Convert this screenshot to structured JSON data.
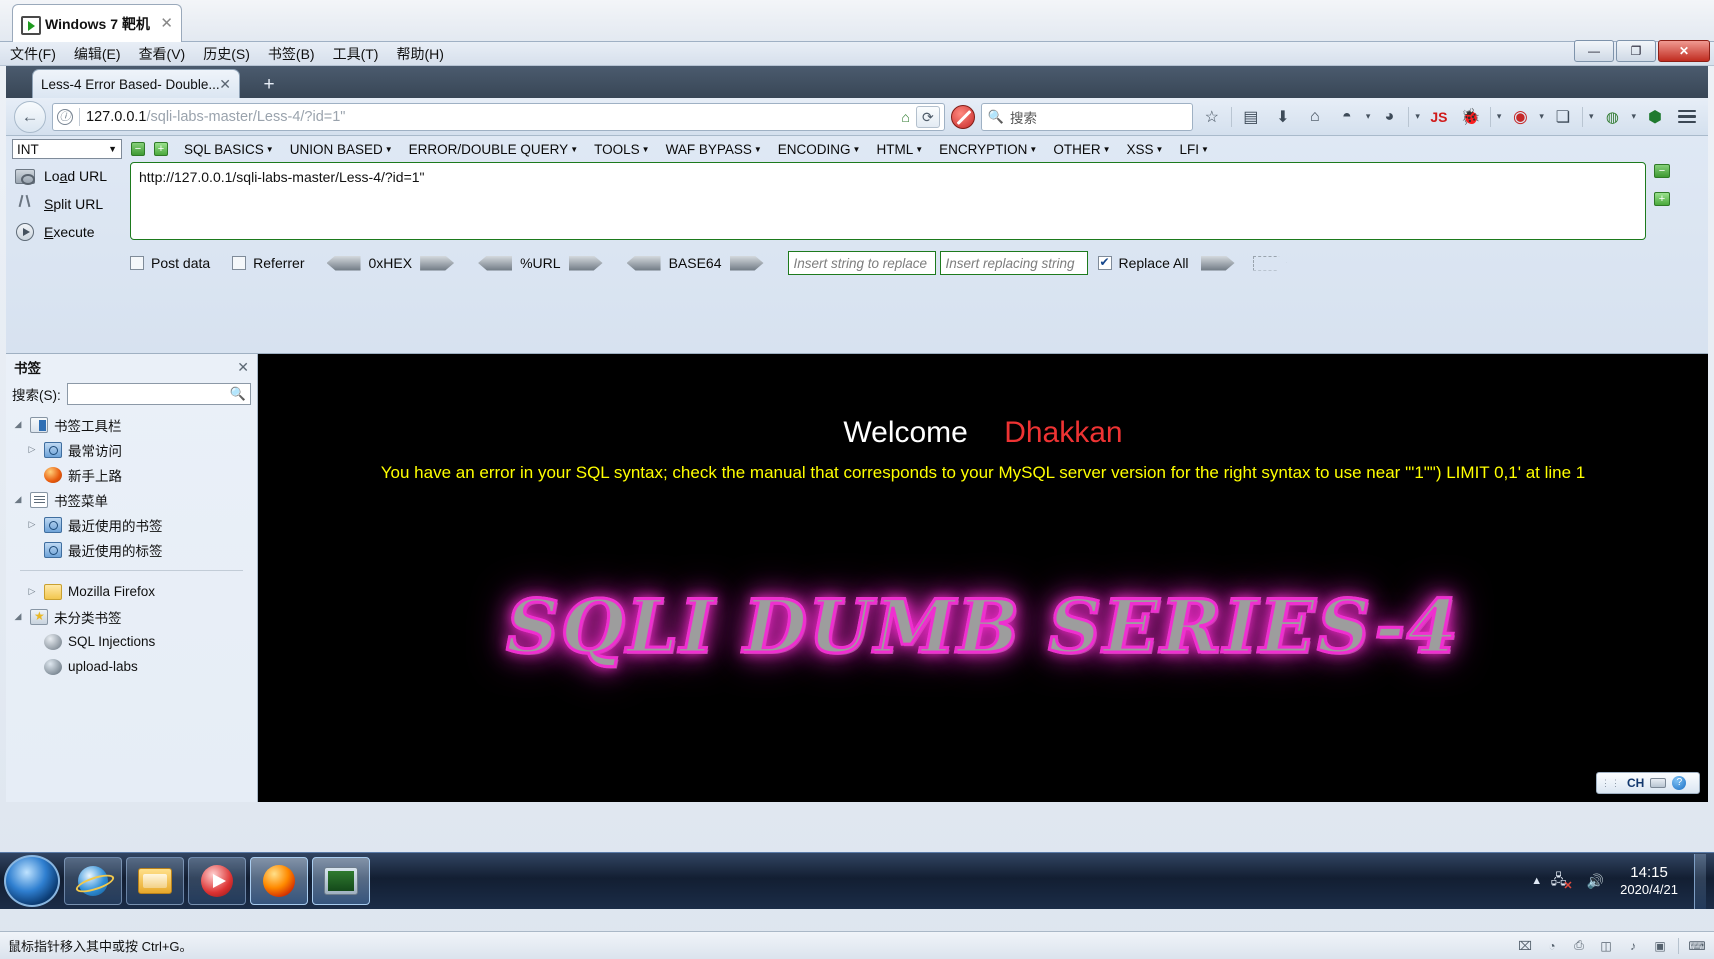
{
  "vm": {
    "tab_title": "Windows 7 靶机",
    "tab_icon": "vm-screen-icon",
    "close_label": "✕",
    "menus": [
      {
        "label": "文件(F)",
        "name": "menu-file"
      },
      {
        "label": "编辑(E)",
        "name": "menu-edit"
      },
      {
        "label": "查看(V)",
        "name": "menu-view"
      },
      {
        "label": "历史(S)",
        "name": "menu-history"
      },
      {
        "label": "书签(B)",
        "name": "menu-bookmarks"
      },
      {
        "label": "工具(T)",
        "name": "menu-tools"
      },
      {
        "label": "帮助(H)",
        "name": "menu-help"
      }
    ],
    "window_controls": {
      "minimize": "—",
      "maximize": "❐",
      "close": "✕"
    },
    "status_hint": "鼠标指针移入其中或按 Ctrl+G。"
  },
  "firefox": {
    "tab": {
      "title": "Less-4 Error Based- Double...",
      "close": "✕"
    },
    "newtab_label": "+",
    "back_label": "←",
    "urlbar": {
      "info_icon": "ⓘ",
      "host": "127.0.0.1",
      "path": "/sqli-labs-master/Less-4/?id=1\"",
      "home_icon": "⌂",
      "reload_icon": "⟳"
    },
    "noscript_icon": "noscript-icon",
    "search": {
      "icon": "🔍",
      "placeholder": "搜索",
      "value": ""
    },
    "toolbar_icons": [
      {
        "name": "bookmark-star-icon",
        "glyph": "☆"
      },
      {
        "name": "library-icon",
        "glyph": "▤"
      },
      {
        "name": "downloads-icon",
        "glyph": "⬇"
      },
      {
        "name": "home-icon",
        "glyph": "⌂"
      },
      {
        "name": "user-agent-switcher-icon",
        "glyph": "◓"
      },
      {
        "name": "cookie-manager-icon",
        "glyph": "◕"
      },
      {
        "name": "javascript-toggle-icon",
        "glyph": "JS"
      },
      {
        "name": "firebug-icon",
        "glyph": "🐞"
      },
      {
        "name": "tamper-data-icon",
        "glyph": "◉"
      },
      {
        "name": "proxy-switch-icon",
        "glyph": "❏"
      },
      {
        "name": "extension-globe-icon",
        "glyph": "◍"
      },
      {
        "name": "shield-icon",
        "glyph": "⬢"
      },
      {
        "name": "menu-hamburger-icon",
        "glyph": "≡"
      }
    ]
  },
  "hackbar": {
    "type_select": {
      "value": "INT",
      "caret": "▼"
    },
    "minus_button": "−",
    "plus_button": "+",
    "menus": [
      "SQL BASICS",
      "UNION BASED",
      "ERROR/DOUBLE QUERY",
      "TOOLS",
      "WAF BYPASS",
      "ENCODING",
      "HTML",
      "ENCRYPTION",
      "OTHER",
      "XSS",
      "LFI"
    ],
    "actions": [
      {
        "label": "Load URL",
        "name": "load-url-button",
        "icon": "load-url-icon"
      },
      {
        "label": "Split URL",
        "name": "split-url-button",
        "icon": "split-url-icon"
      },
      {
        "label": "Execute",
        "name": "execute-button",
        "icon": "execute-icon"
      }
    ],
    "url_textarea": "http://127.0.0.1/sqli-labs-master/Less-4/?id=1\"",
    "options": {
      "post_data": {
        "label": "Post data",
        "checked": false
      },
      "referrer": {
        "label": "Referrer",
        "checked": false
      },
      "replace_all": {
        "label": "Replace All",
        "checked": true
      }
    },
    "encoders": [
      "0xHEX",
      "%URL",
      "BASE64"
    ],
    "replace_from_placeholder": "Insert string to replace",
    "replace_to_placeholder": "Insert replacing string"
  },
  "sidebar": {
    "title": "书签",
    "close": "✕",
    "search_label": "搜索(S):",
    "search_value": "",
    "search_icon": "search-icon",
    "tree": [
      {
        "label": "书签工具栏",
        "icon": "bookmarks-toolbar-icon",
        "twisty": "◢",
        "depth": 0
      },
      {
        "label": "最常访问",
        "icon": "smart-query-icon",
        "twisty": "▷",
        "depth": 1
      },
      {
        "label": "新手上路",
        "icon": "firefox-icon",
        "twisty": "",
        "depth": 1
      },
      {
        "label": "书签菜单",
        "icon": "bookmarks-menu-icon",
        "twisty": "◢",
        "depth": 0
      },
      {
        "label": "最近使用的书签",
        "icon": "smart-query-icon",
        "twisty": "▷",
        "depth": 1
      },
      {
        "label": "最近使用的标签",
        "icon": "smart-query-icon",
        "twisty": "",
        "depth": 1
      },
      {
        "label": "Mozilla Firefox",
        "icon": "folder-icon",
        "twisty": "▷",
        "depth": 1
      },
      {
        "label": "未分类书签",
        "icon": "unsorted-bookmarks-icon",
        "twisty": "◢",
        "depth": 0
      },
      {
        "label": "SQL Injections",
        "icon": "globe-icon",
        "twisty": "",
        "depth": 1
      },
      {
        "label": "upload-labs",
        "icon": "globe-icon",
        "twisty": "",
        "depth": 1
      }
    ]
  },
  "page": {
    "welcome": "Welcome",
    "dhakkan": "Dhakkan",
    "error": "You have an error in your SQL syntax; check the manual that corresponds to your MySQL server version for the right syntax to use near '\"1\"\") LIMIT 0,1' at line 1",
    "banner": "SQLI DUMB SERIES-4",
    "background_color": "#000000",
    "error_color": "#ffff00",
    "dhakkan_color": "#ee3333",
    "banner_glow_color": "#ef2fd0"
  },
  "ime": {
    "dots": "⠿",
    "language": "CH",
    "keyboard_icon": "keyboard-icon",
    "help_icon": "help-icon"
  },
  "taskbar": {
    "start_button": "start-orb",
    "items": [
      {
        "name": "taskbar-internet-explorer",
        "icon": "ie-icon",
        "active": false
      },
      {
        "name": "taskbar-file-explorer",
        "icon": "explorer-icon",
        "active": false
      },
      {
        "name": "taskbar-media-player",
        "icon": "media-player-icon",
        "active": false
      },
      {
        "name": "taskbar-firefox",
        "icon": "firefox-icon",
        "active": true
      },
      {
        "name": "taskbar-hacker-tool",
        "icon": "hacker-tool-icon",
        "active": true
      }
    ],
    "tray": {
      "show_hidden": "▲",
      "network_icon": "network-icon",
      "network_badge": "✕",
      "volume_icon": "🔊",
      "time": "14:15",
      "date": "2020/4/21"
    }
  },
  "vm_statusbar": {
    "hint": "鼠标指针移入其中或按 Ctrl+G。",
    "icons": [
      "⌧",
      "◔",
      "⎙",
      "◫",
      "♪",
      "▣",
      "⌨"
    ]
  }
}
